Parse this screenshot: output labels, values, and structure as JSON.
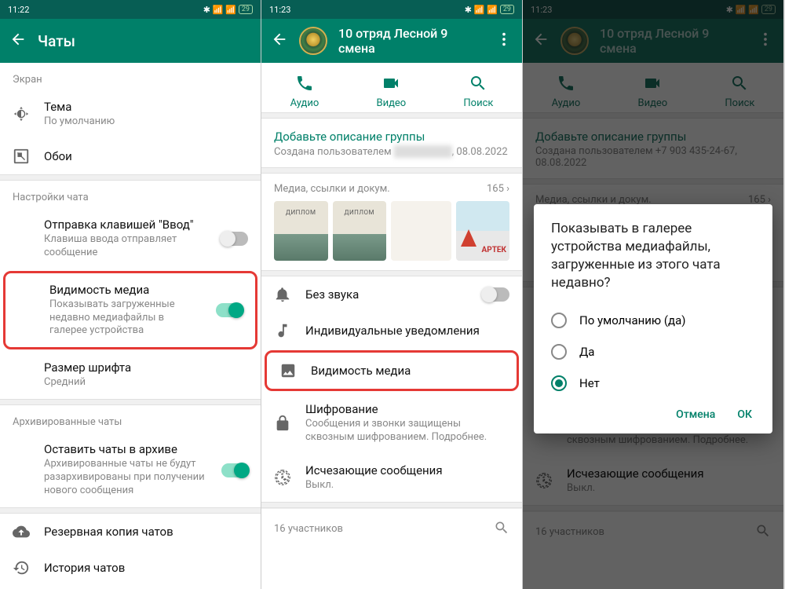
{
  "pane1": {
    "status": {
      "time": "11:22",
      "battery": "29"
    },
    "title": "Чаты",
    "section_screen": "Экран",
    "theme": {
      "title": "Тема",
      "sub": "По умолчанию"
    },
    "wallpaper": "Обои",
    "section_chat_settings": "Настройки чата",
    "enter_send": {
      "title": "Отправка клавишей \"Ввод\"",
      "sub": "Клавиша ввода отправляет сообщение"
    },
    "media_vis": {
      "title": "Видимость медиа",
      "sub": "Показывать загруженные недавно медиафайлы в галерее устройства"
    },
    "font_size": {
      "title": "Размер шрифта",
      "sub": "Средний"
    },
    "section_archived": "Архивированные чаты",
    "keep_archived": {
      "title": "Оставить чаты в архиве",
      "sub": "Архивированные чаты не будут разархивированы при получении нового сообщения"
    },
    "backup": "Резервная копия чатов",
    "history": "История чатов"
  },
  "pane2": {
    "status": {
      "time": "11:23",
      "battery": "29"
    },
    "title": "10 отряд Лесной 9 смена",
    "actions": {
      "audio": "Аудио",
      "video": "Видео",
      "search": "Поиск"
    },
    "add_desc": "Добавьте описание группы",
    "created_prefix": "Создана пользователем",
    "created_date": ", 08.08.2022",
    "media_header": "Медиа, ссылки и докум.",
    "media_count": "165 ›",
    "mute": "Без звука",
    "custom_notif": "Индивидуальные уведомления",
    "media_vis": "Видимость медиа",
    "encryption": {
      "title": "Шифрование",
      "sub": "Сообщения и звонки защищены сквозным шифрованием. Подробнее."
    },
    "disappearing": {
      "title": "Исчезающие сообщения",
      "sub": "Выкл."
    },
    "participants": "16 участников"
  },
  "pane3": {
    "status": {
      "time": "11:23",
      "battery": "29"
    },
    "title": "10 отряд Лесной 9 смена",
    "created_prefix": "Создана пользователем",
    "created_phone": "+7 903 435-24-67",
    "created_date": ", 08.08.2022",
    "dialog": {
      "title": "Показывать в галерее устройства медиафайлы, загруженные из этого чата недавно?",
      "opt_default": "По умолчанию (да)",
      "opt_yes": "Да",
      "opt_no": "Нет",
      "cancel": "Отмена",
      "ok": "ОК"
    }
  }
}
